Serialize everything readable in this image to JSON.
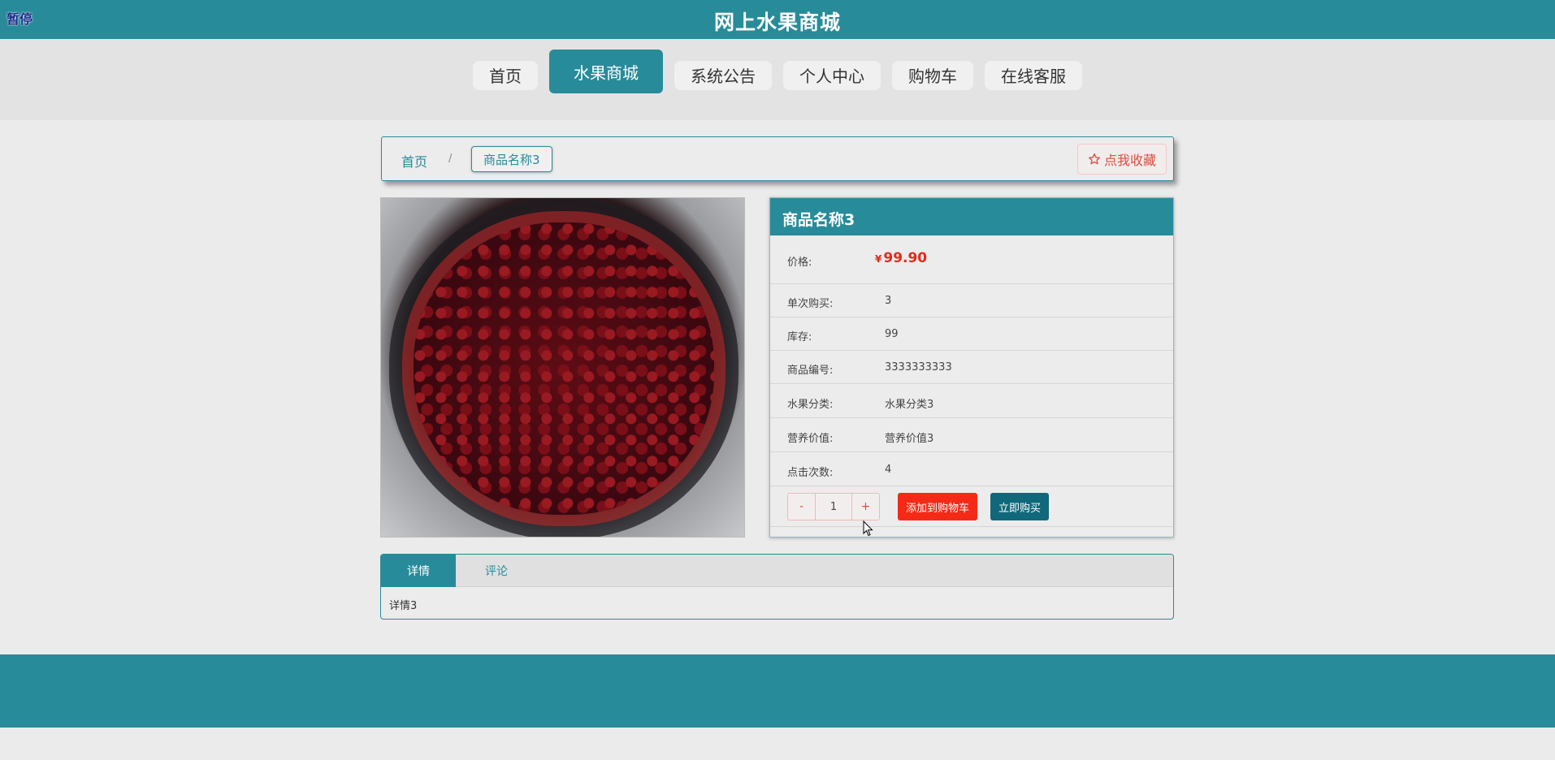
{
  "header": {
    "title": "网上水果商城",
    "pause_label": "暂停"
  },
  "nav": {
    "items": [
      {
        "label": "首页"
      },
      {
        "label": "水果商城",
        "active": true
      },
      {
        "label": "系统公告"
      },
      {
        "label": "个人中心"
      },
      {
        "label": "购物车"
      },
      {
        "label": "在线客服"
      }
    ]
  },
  "breadcrumb": {
    "home": "首页",
    "separator": "/",
    "current": "商品名称3",
    "favorite_label": "点我收藏"
  },
  "product": {
    "name": "商品名称3",
    "image_icon": "cherry-bouquet-image",
    "price_label": "价格:",
    "currency": "¥",
    "price": "99.90",
    "fields": [
      {
        "label": "单次购买:",
        "value": "3"
      },
      {
        "label": "库存:",
        "value": "99"
      },
      {
        "label": "商品编号:",
        "value": "3333333333"
      },
      {
        "label": "水果分类:",
        "value": "水果分类3"
      },
      {
        "label": "营养价值:",
        "value": "营养价值3"
      },
      {
        "label": "点击次数:",
        "value": "4"
      }
    ],
    "quantity": "1",
    "minus": "-",
    "plus": "+",
    "add_to_cart": "添加到购物车",
    "buy_now": "立即购买"
  },
  "tabs": {
    "items": [
      {
        "label": "详情",
        "active": true
      },
      {
        "label": "评论"
      }
    ],
    "content": "详情3"
  },
  "colors": {
    "primary": "#288b99",
    "price": "#e12a1f",
    "add_cart": "#f52a16",
    "buy_now": "#11687a"
  }
}
